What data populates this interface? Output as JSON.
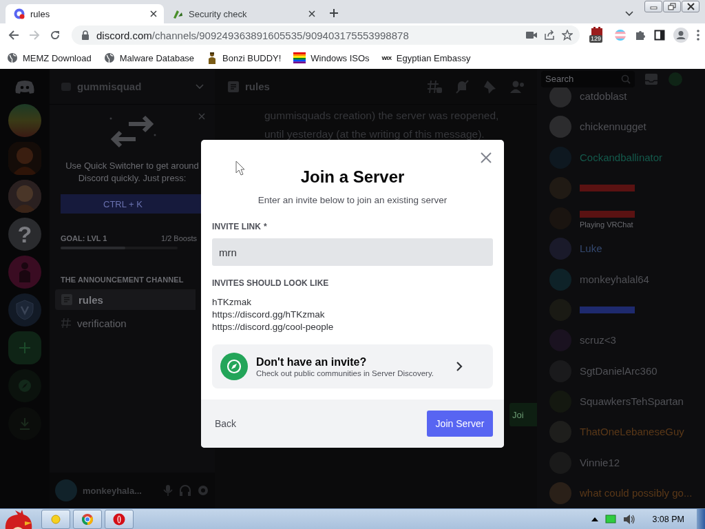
{
  "browser": {
    "tabs": [
      {
        "title": "rules",
        "selected": true
      },
      {
        "title": "Security check",
        "selected": false
      }
    ],
    "address": {
      "domain": "discord.com",
      "path": "/channels/909249363891605535/909403175553998878"
    },
    "extension_badge": "129",
    "bookmarks": [
      {
        "label": "MEMZ Download",
        "kind": "globe"
      },
      {
        "label": "Malware Database",
        "kind": "globe"
      },
      {
        "label": "Bonzi BUDDY!",
        "kind": "figure"
      },
      {
        "label": "Windows ISOs",
        "kind": "rainbow"
      },
      {
        "label": "Egyptian Embassy",
        "kind": "wix",
        "icon_text": "WIX"
      }
    ]
  },
  "discord": {
    "servers": [
      {
        "kind": "rainbow",
        "selected": false
      },
      {
        "kind": "picture",
        "selected": true
      },
      {
        "kind": "picture",
        "selected": false
      },
      {
        "kind": "text",
        "text": "?",
        "selected": false
      },
      {
        "kind": "magenta",
        "selected": false
      },
      {
        "kind": "shield",
        "selected": false
      }
    ],
    "rail_actions": [
      {
        "kind": "add"
      },
      {
        "kind": "explore"
      },
      {
        "kind": "download"
      }
    ],
    "server_name": "gummisquad",
    "quick_switcher": {
      "text": "Use Quick Switcher to get around Discord quickly. Just press:",
      "shortcut": "CTRL + K"
    },
    "boost_goal": {
      "label": "GOAL: LVL 1",
      "count": "1/2 Boosts",
      "level": 0.55
    },
    "category": "THE ANNOUNCEMENT CHANNEL",
    "channels": [
      {
        "name": "rules",
        "kind": "text",
        "selected": true
      },
      {
        "name": "verification",
        "kind": "thread",
        "selected": false
      }
    ],
    "user": {
      "name": "monkeyhala..."
    },
    "chat": {
      "channel": "rules",
      "message_lines": [
        "gummisquads creation) the server was reopened,",
        "until yesterday (at the writing of this message)."
      ],
      "side_button": "Joi"
    },
    "search": {
      "placeholder": "Search"
    },
    "members": [
      {
        "name": "catdoblast",
        "color": "#505156"
      },
      {
        "name": "chickennugget",
        "color": "#505156"
      },
      {
        "name": "Cockandballinator",
        "color": "#145a4c"
      },
      {
        "color": "#5a1212"
      },
      {
        "color": "#5a1212",
        "status": "Playing VRChat"
      },
      {
        "name": "Luke",
        "color": "#34486e"
      },
      {
        "name": "monkeyhalal64",
        "color": "#505156"
      },
      {
        "color": "#1e2a6e"
      },
      {
        "name": "scruz<3",
        "color": "#505156"
      },
      {
        "name": "SgtDanielArc360",
        "color": "#505156"
      },
      {
        "name": "SquawkersTehSpartan",
        "color": "#505156"
      },
      {
        "name": "ThatOneLebaneseGuy",
        "color": "#5a3818"
      },
      {
        "name": "Vinnie12",
        "color": "#505156"
      },
      {
        "name": "what could possibly go...",
        "color": "#5a3818"
      }
    ]
  },
  "modal": {
    "title": "Join a Server",
    "subtitle": "Enter an invite below to join an existing server",
    "field_label": "INVITE LINK",
    "required_mark": "*",
    "value": "mrn",
    "examples_heading": "INVITES SHOULD LOOK LIKE",
    "examples": [
      "hTKzmak",
      "https://discord.gg/hTKzmak",
      "https://discord.gg/cool-people"
    ],
    "discovery": {
      "title": "Don't have an invite?",
      "subtitle": "Check out public communities in Server Discovery."
    },
    "back": "Back",
    "submit": "Join Server"
  },
  "taskbar": {
    "apps": [
      {
        "kind": "folder"
      },
      {
        "kind": "chrome"
      },
      {
        "kind": "opera"
      }
    ],
    "clock": "3:08 PM"
  }
}
